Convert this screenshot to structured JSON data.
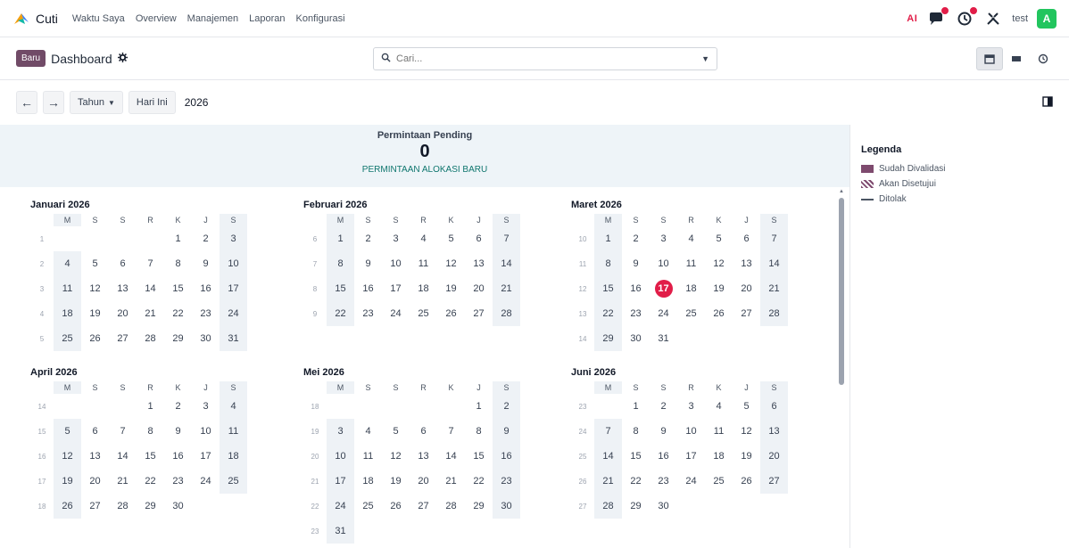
{
  "app": {
    "name": "Cuti",
    "menu": [
      "Waktu Saya",
      "Overview",
      "Manajemen",
      "Laporan",
      "Konfigurasi"
    ]
  },
  "systray": {
    "ai_label": "AI",
    "company": "test",
    "avatar_letter": "A",
    "accent_color": "#714b67",
    "badge_color": "#e11d48"
  },
  "control": {
    "new_button": "Baru",
    "breadcrumb": "Dashboard",
    "search_placeholder": "Cari..."
  },
  "toolbar": {
    "scale_label": "Tahun",
    "today_label": "Hari Ini",
    "period": "2026"
  },
  "pending": {
    "title": "Permintaan Pending",
    "count": "0",
    "link": "PERMINTAAN ALOKASI BARU"
  },
  "calendar": {
    "weekday_headers": [
      "M",
      "S",
      "S",
      "R",
      "K",
      "J",
      "S"
    ],
    "today": "2026-03-17",
    "months": [
      {
        "title": "Januari 2026",
        "weeks": [
          {
            "wk": "1",
            "days": [
              "",
              "",
              "",
              "",
              "1",
              "2",
              "3"
            ]
          },
          {
            "wk": "2",
            "days": [
              "4",
              "5",
              "6",
              "7",
              "8",
              "9",
              "10"
            ]
          },
          {
            "wk": "3",
            "days": [
              "11",
              "12",
              "13",
              "14",
              "15",
              "16",
              "17"
            ]
          },
          {
            "wk": "4",
            "days": [
              "18",
              "19",
              "20",
              "21",
              "22",
              "23",
              "24"
            ]
          },
          {
            "wk": "5",
            "days": [
              "25",
              "26",
              "27",
              "28",
              "29",
              "30",
              "31"
            ]
          }
        ]
      },
      {
        "title": "Februari 2026",
        "weeks": [
          {
            "wk": "6",
            "days": [
              "1",
              "2",
              "3",
              "4",
              "5",
              "6",
              "7"
            ]
          },
          {
            "wk": "7",
            "days": [
              "8",
              "9",
              "10",
              "11",
              "12",
              "13",
              "14"
            ]
          },
          {
            "wk": "8",
            "days": [
              "15",
              "16",
              "17",
              "18",
              "19",
              "20",
              "21"
            ]
          },
          {
            "wk": "9",
            "days": [
              "22",
              "23",
              "24",
              "25",
              "26",
              "27",
              "28"
            ]
          }
        ]
      },
      {
        "title": "Maret 2026",
        "weeks": [
          {
            "wk": "10",
            "days": [
              "1",
              "2",
              "3",
              "4",
              "5",
              "6",
              "7"
            ]
          },
          {
            "wk": "11",
            "days": [
              "8",
              "9",
              "10",
              "11",
              "12",
              "13",
              "14"
            ]
          },
          {
            "wk": "12",
            "days": [
              "15",
              "16",
              "17",
              "18",
              "19",
              "20",
              "21"
            ]
          },
          {
            "wk": "13",
            "days": [
              "22",
              "23",
              "24",
              "25",
              "26",
              "27",
              "28"
            ]
          },
          {
            "wk": "14",
            "days": [
              "29",
              "30",
              "31",
              "",
              "",
              "",
              ""
            ]
          }
        ]
      },
      {
        "title": "April 2026",
        "weeks": [
          {
            "wk": "14",
            "days": [
              "",
              "",
              "",
              "1",
              "2",
              "3",
              "4"
            ]
          },
          {
            "wk": "15",
            "days": [
              "5",
              "6",
              "7",
              "8",
              "9",
              "10",
              "11"
            ]
          },
          {
            "wk": "16",
            "days": [
              "12",
              "13",
              "14",
              "15",
              "16",
              "17",
              "18"
            ]
          },
          {
            "wk": "17",
            "days": [
              "19",
              "20",
              "21",
              "22",
              "23",
              "24",
              "25"
            ]
          },
          {
            "wk": "18",
            "days": [
              "26",
              "27",
              "28",
              "29",
              "30",
              "",
              ""
            ]
          }
        ]
      },
      {
        "title": "Mei 2026",
        "weeks": [
          {
            "wk": "18",
            "days": [
              "",
              "",
              "",
              "",
              "",
              "1",
              "2"
            ]
          },
          {
            "wk": "19",
            "days": [
              "3",
              "4",
              "5",
              "6",
              "7",
              "8",
              "9"
            ]
          },
          {
            "wk": "20",
            "days": [
              "10",
              "11",
              "12",
              "13",
              "14",
              "15",
              "16"
            ]
          },
          {
            "wk": "21",
            "days": [
              "17",
              "18",
              "19",
              "20",
              "21",
              "22",
              "23"
            ]
          },
          {
            "wk": "22",
            "days": [
              "24",
              "25",
              "26",
              "27",
              "28",
              "29",
              "30"
            ]
          },
          {
            "wk": "23",
            "days": [
              "31",
              "",
              "",
              "",
              "",
              "",
              ""
            ]
          }
        ]
      },
      {
        "title": "Juni 2026",
        "weeks": [
          {
            "wk": "23",
            "days": [
              "",
              "1",
              "2",
              "3",
              "4",
              "5",
              "6"
            ]
          },
          {
            "wk": "24",
            "days": [
              "7",
              "8",
              "9",
              "10",
              "11",
              "12",
              "13"
            ]
          },
          {
            "wk": "25",
            "days": [
              "14",
              "15",
              "16",
              "17",
              "18",
              "19",
              "20"
            ]
          },
          {
            "wk": "26",
            "days": [
              "21",
              "22",
              "23",
              "24",
              "25",
              "26",
              "27"
            ]
          },
          {
            "wk": "27",
            "days": [
              "28",
              "29",
              "30",
              "",
              "",
              "",
              ""
            ]
          }
        ]
      }
    ]
  },
  "legend": {
    "title": "Legenda",
    "items": [
      {
        "label": "Sudah Divalidasi",
        "swatch": "solid"
      },
      {
        "label": "Akan Disetujui",
        "swatch": "hatch"
      },
      {
        "label": "Ditolak",
        "swatch": "line"
      }
    ]
  }
}
